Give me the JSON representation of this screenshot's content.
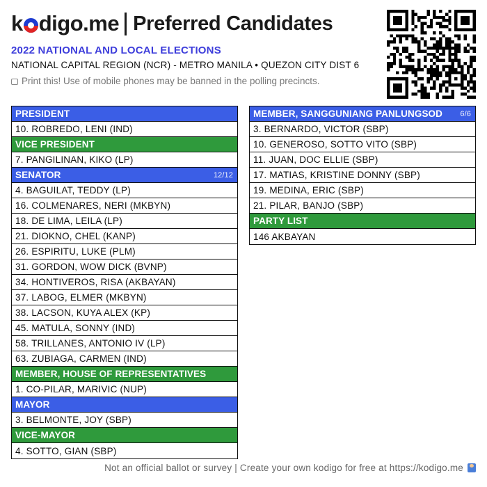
{
  "header": {
    "brand_part1": "k",
    "brand_part2": "digo.me",
    "title": "Preferred Candidates",
    "election": "2022 NATIONAL AND LOCAL ELECTIONS",
    "region": "NATIONAL CAPITAL REGION (NCR) - METRO MANILA • QUEZON CITY DIST 6",
    "print_note": "Print this! Use of mobile phones may be banned in the polling precincts."
  },
  "colors": {
    "blue": "#3b5ee6",
    "green": "#2f9a3c",
    "accent_text": "#3d3ddb"
  },
  "left_sections": [
    {
      "title": "PRESIDENT",
      "color": "blue",
      "count": "",
      "candidates": [
        "10. ROBREDO, LENI (IND)"
      ]
    },
    {
      "title": "VICE PRESIDENT",
      "color": "green",
      "count": "",
      "candidates": [
        "7. PANGILINAN, KIKO (LP)"
      ]
    },
    {
      "title": "SENATOR",
      "color": "blue",
      "count": "12/12",
      "candidates": [
        "4. BAGUILAT, TEDDY (LP)",
        "16. COLMENARES, NERI (MKBYN)",
        "18. DE LIMA, LEILA (LP)",
        "21. DIOKNO, CHEL (KANP)",
        "26. ESPIRITU, LUKE (PLM)",
        "31. GORDON, WOW DICK (BVNP)",
        "34. HONTIVEROS, RISA (AKBAYAN)",
        "37. LABOG, ELMER (MKBYN)",
        "38. LACSON, KUYA ALEX (KP)",
        "45. MATULA, SONNY (IND)",
        "58. TRILLANES, ANTONIO IV (LP)",
        "63. ZUBIAGA, CARMEN (IND)"
      ]
    },
    {
      "title": "MEMBER, HOUSE OF REPRESENTATIVES",
      "color": "green",
      "count": "",
      "candidates": [
        "1. CO-PILAR, MARIVIC (NUP)"
      ]
    },
    {
      "title": "MAYOR",
      "color": "blue",
      "count": "",
      "candidates": [
        "3. BELMONTE, JOY (SBP)"
      ]
    },
    {
      "title": "VICE-MAYOR",
      "color": "green",
      "count": "",
      "candidates": [
        "4. SOTTO, GIAN (SBP)"
      ]
    }
  ],
  "right_sections": [
    {
      "title": "MEMBER, SANGGUNIANG PANLUNGSOD",
      "color": "blue",
      "count": "6/6",
      "candidates": [
        "3. BERNARDO, VICTOR (SBP)",
        "10. GENEROSO, SOTTO VITO (SBP)",
        "11. JUAN, DOC ELLIE (SBP)",
        "17. MATIAS, KRISTINE DONNY (SBP)",
        "19. MEDINA, ERIC (SBP)",
        "21. PILAR, BANJO (SBP)"
      ]
    },
    {
      "title": "PARTY LIST",
      "color": "green",
      "count": "",
      "candidates": [
        "146 AKBAYAN"
      ]
    }
  ],
  "footer": {
    "text": "Not an official ballot or survey | Create your own kodigo for free at https://kodigo.me"
  }
}
